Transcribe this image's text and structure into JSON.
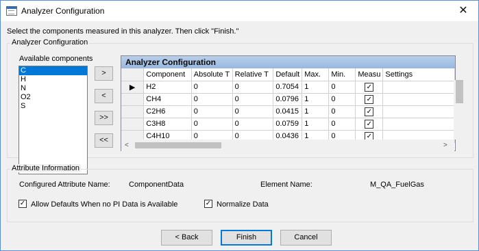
{
  "window": {
    "title": "Analyzer Configuration",
    "close_glyph": "✕"
  },
  "instruction": "Select the components measured in this analyzer. Then click \"Finish.\"",
  "analyzer_group": {
    "label": "Analyzer Configuration",
    "available_label": "Available components",
    "available_components": [
      "C",
      "H",
      "N",
      "O2",
      "S"
    ],
    "selected_index": 0,
    "move_buttons": {
      "add": ">",
      "remove": "<",
      "add_all": ">>",
      "remove_all": "<<"
    }
  },
  "grid": {
    "caption": "Analyzer Configuration",
    "columns": [
      "Component",
      "Absolute T",
      "Relative T",
      "Default",
      "Max.",
      "Min.",
      "Measu",
      "Settings"
    ],
    "current_row_marker": "▶",
    "rows": [
      {
        "component": "H2",
        "absolute_t": "0",
        "relative_t": "0",
        "default": "0.7054",
        "max": "1",
        "min": "0",
        "measured": true,
        "settings": ""
      },
      {
        "component": "CH4",
        "absolute_t": "0",
        "relative_t": "0",
        "default": "0.0796",
        "max": "1",
        "min": "0",
        "measured": true,
        "settings": ""
      },
      {
        "component": "C2H6",
        "absolute_t": "0",
        "relative_t": "0",
        "default": "0.0415",
        "max": "1",
        "min": "0",
        "measured": true,
        "settings": ""
      },
      {
        "component": "C3H8",
        "absolute_t": "0",
        "relative_t": "0",
        "default": "0.0759",
        "max": "1",
        "min": "0",
        "measured": true,
        "settings": ""
      },
      {
        "component": "C4H10",
        "absolute_t": "0",
        "relative_t": "0",
        "default": "0.0436",
        "max": "1",
        "min": "0",
        "measured": true,
        "settings": ""
      }
    ],
    "scroll_left": "<",
    "scroll_right": ">"
  },
  "attribute_group": {
    "label": "Attribute Information",
    "configured_attribute_label": "Configured Attribute Name:",
    "configured_attribute_value": "ComponentData",
    "element_name_label": "Element Name:",
    "element_name_value": "M_QA_FuelGas",
    "allow_defaults_label": "Allow Defaults When no PI Data is Available",
    "allow_defaults_checked": true,
    "normalize_label": "Normalize Data",
    "normalize_checked": true,
    "check_glyph": "✓"
  },
  "buttons": {
    "back": "< Back",
    "finish": "Finish",
    "cancel": "Cancel"
  }
}
